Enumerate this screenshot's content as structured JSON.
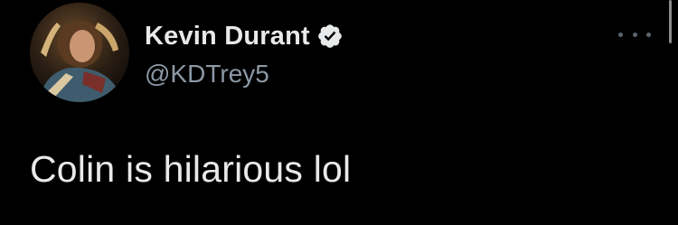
{
  "tweet": {
    "author": {
      "display_name": "Kevin Durant",
      "handle": "@KDTrey5",
      "verified": true,
      "avatar_icon": "profile-photo-avatar",
      "verified_icon": "verified-badge-icon"
    },
    "text": "Colin is hilarious lol",
    "more_icon": "more-options-icon"
  },
  "colors": {
    "background": "#000000",
    "primary_text": "#e7e9ea",
    "secondary_text": "#8b98a5",
    "verified_badge": "#e7e9ea"
  }
}
